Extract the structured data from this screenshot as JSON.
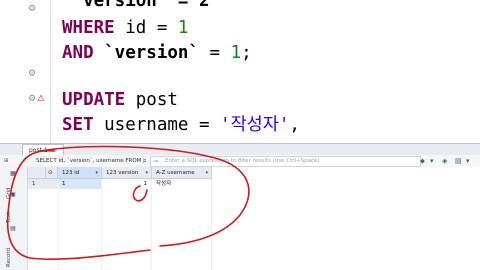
{
  "editor": {
    "lines": [
      {
        "parts": [
          {
            "t": " `version` = 2",
            "c": "bq"
          }
        ]
      },
      {
        "parts": [
          {
            "t": "WHERE",
            "c": "kw"
          },
          {
            "t": " id = ",
            "c": "op"
          },
          {
            "t": "1",
            "c": "num"
          }
        ]
      },
      {
        "parts": [
          {
            "t": "AND",
            "c": "kw"
          },
          {
            "t": " `version`",
            "c": "bq"
          },
          {
            "t": " = ",
            "c": "op"
          },
          {
            "t": "1",
            "c": "num"
          },
          {
            "t": ";",
            "c": "op"
          }
        ]
      },
      {
        "parts": [
          {
            "t": "",
            "c": "op"
          }
        ]
      },
      {
        "parts": [
          {
            "t": "UPDATE",
            "c": "kw"
          },
          {
            "t": " post",
            "c": "op"
          }
        ]
      },
      {
        "parts": [
          {
            "t": "SET",
            "c": "kw"
          },
          {
            "t": " username = ",
            "c": "op"
          },
          {
            "t": "'작성자'",
            "c": "str"
          },
          {
            "t": ",",
            "c": "op"
          }
        ]
      }
    ],
    "gutter_markers": {
      "warning_label": "⚠",
      "info_label": "⚙"
    }
  },
  "results": {
    "tab_label": "post 1",
    "tab_close": "✕",
    "sql_preview": "SELECT id, `version`, username FROM po",
    "filter_placeholder": "Enter a SQL expression to filter results (use Ctrl+Space)",
    "side": {
      "grid_label": "Grid",
      "text_label": "Text",
      "record_label": "Record"
    },
    "columns": [
      {
        "label": "123 id",
        "selected": true
      },
      {
        "label": "123 version",
        "selected": false
      },
      {
        "label": "A-Z username",
        "selected": false
      }
    ],
    "rows": [
      {
        "rownum": "1",
        "id": "1",
        "version": "1",
        "username": "작성자"
      }
    ]
  },
  "colors": {
    "keyword": "#7f0055",
    "string": "#2a00ff",
    "number": "#0a8a0a",
    "annotation": "#d11a1a"
  }
}
